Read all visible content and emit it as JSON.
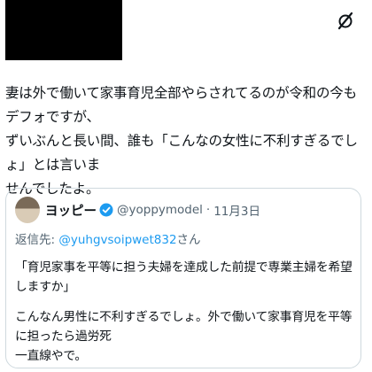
{
  "tweet": {
    "text": "妻は外で働いて家事育児全部やらされてるのが令和の今もデフォですが、\nずいぶんと長い間、誰も「こんなの女性に不利すぎるでしょ」とは言いま\nせんでしたよ。"
  },
  "quote": {
    "name": "ヨッピー",
    "handle": "@yoppymodel",
    "separator": "·",
    "date": "11月3日",
    "reply_prefix": "返信先:",
    "reply_handle": "@yuhgvsoipwet832",
    "reply_suffix": "さん",
    "line1": "「育児家事を平等に担う夫婦を達成した前提で専業主婦を希望しますか」",
    "line2": "こんなん男性に不利すぎるでしょ。外で働いて家事育児を平等に担ったら過労死\n一直線やで。"
  },
  "icons": [
    "grok-icon",
    "verified-badge-icon"
  ],
  "colors": {
    "accent": "#1d9bf0",
    "muted": "#536471",
    "border": "#cfd9de"
  }
}
